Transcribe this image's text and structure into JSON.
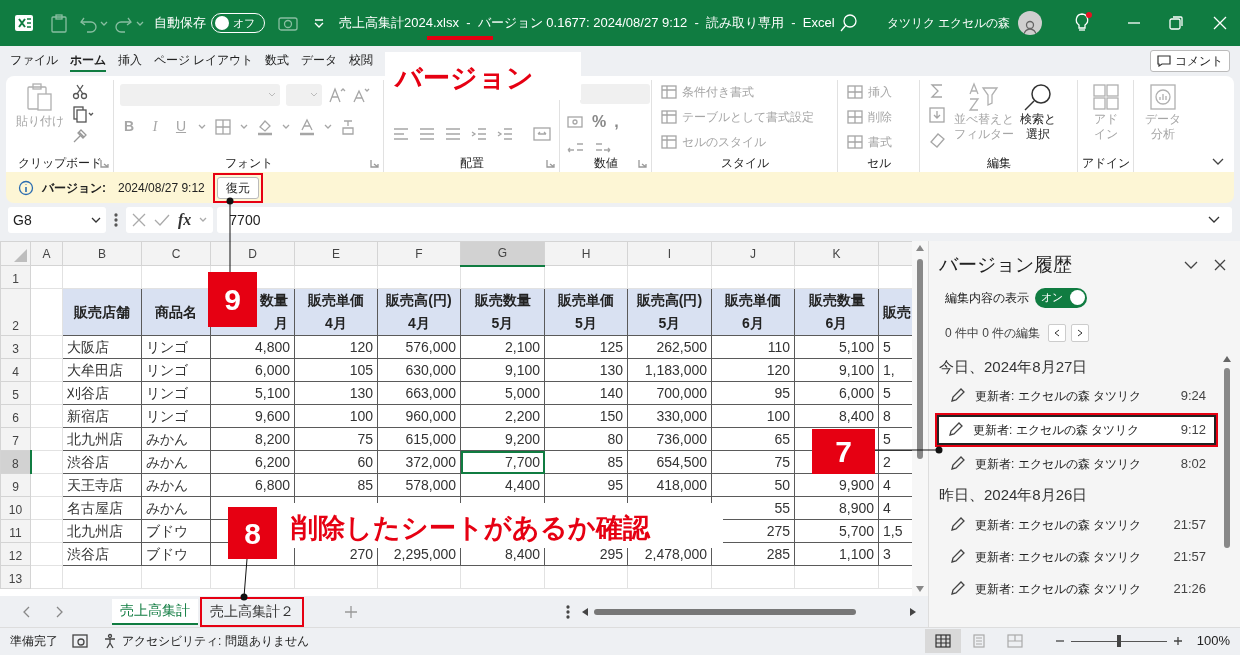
{
  "title_bar": {
    "autosave_label": "自動保存",
    "autosave_on": false,
    "autosave_state": "オフ",
    "title": "売上高集計2024.xlsx  -  バージョン 0.1677: 2024/08/27 9:12  -  読み取り専用  -  Excel",
    "title_underline": true,
    "user": "タツリク エクセルの森",
    "notification": true
  },
  "menu_tabs": [
    {
      "label": "ファイル",
      "selected": false
    },
    {
      "label": "ホーム",
      "selected": true
    },
    {
      "label": "挿入",
      "selected": false
    },
    {
      "label": "ページ レイアウト",
      "selected": false
    },
    {
      "label": "数式",
      "selected": false
    },
    {
      "label": "データ",
      "selected": false
    },
    {
      "label": "校閲",
      "selected": false
    }
  ],
  "comment_button": "コメント",
  "ribbon": {
    "clipboard": {
      "paste": "貼り付け",
      "label": "クリップボード"
    },
    "font": {
      "label": "フォント",
      "format_buttons": [
        "B",
        "I",
        "U"
      ]
    },
    "alignment": {
      "label": "配置"
    },
    "number": {
      "label": "数値",
      "symbols": [
        "%",
        ","
      ]
    },
    "styles": {
      "label": "スタイル",
      "items": [
        "条件付き書式",
        "テーブルとして書式設定",
        "セルのスタイル"
      ]
    },
    "cells": {
      "label": "セル",
      "items": [
        "挿入",
        "削除",
        "書式"
      ]
    },
    "editing": {
      "label": "編集",
      "sort_filter": [
        "並べ替えと",
        "フィルター"
      ],
      "find_select": [
        "検索と",
        "選択"
      ]
    },
    "addins": {
      "label": "アドイン",
      "addins_button": [
        "アド",
        "イン"
      ],
      "data_analysis": [
        "データ",
        "分析"
      ]
    }
  },
  "version_bar": {
    "label": "バージョン:",
    "timestamp": "2024/08/27 9:12",
    "restore_button": "復元",
    "highlighted": true
  },
  "formula_bar": {
    "name_box": "G8",
    "function_label": "fx",
    "value": "7700"
  },
  "sheet": {
    "columns": [
      {
        "label": "A",
        "selected": false
      },
      {
        "label": "B",
        "kind": "text",
        "selected": false
      },
      {
        "label": "C",
        "kind": "text",
        "selected": false
      },
      {
        "label": "D",
        "kind": "number",
        "selected": false
      },
      {
        "label": "E",
        "kind": "number",
        "selected": false
      },
      {
        "label": "F",
        "kind": "number",
        "selected": false
      },
      {
        "label": "G",
        "kind": "number",
        "selected": true
      },
      {
        "label": "H",
        "kind": "number",
        "selected": false
      },
      {
        "label": "I",
        "kind": "number",
        "selected": false
      },
      {
        "label": "J",
        "kind": "number",
        "selected": false
      },
      {
        "label": "K",
        "kind": "number",
        "selected": false
      },
      {
        "kind": "cut",
        "selected": false
      }
    ],
    "rows": [
      {
        "number": "1",
        "kind": "blank",
        "selected": false
      },
      {
        "number": "2",
        "kind": "header",
        "selected": false,
        "cells": [
          {
            "lines": [
              "販売店舗"
            ]
          },
          {
            "lines": [
              "商品名"
            ]
          },
          {
            "lines": [
              "数量",
              "月"
            ],
            "partly_covered": true
          },
          {
            "lines": [
              "販売単価",
              "4月"
            ]
          },
          {
            "lines": [
              "販売高(円)",
              "4月"
            ]
          },
          {
            "lines": [
              "販売数量",
              "5月"
            ]
          },
          {
            "lines": [
              "販売単価",
              "5月"
            ]
          },
          {
            "lines": [
              "販売高(円)",
              "5月"
            ]
          },
          {
            "lines": [
              "販売単価",
              "6月"
            ]
          },
          {
            "lines": [
              "販売数量",
              "6月"
            ]
          },
          {
            "lines": [
              "販売"
            ]
          }
        ]
      },
      {
        "number": "3",
        "kind": "data",
        "selected": false,
        "cells": [
          "大阪店",
          "リンゴ",
          "4,800",
          "120",
          "576,000",
          "2,100",
          "125",
          "262,500",
          "110",
          "5,100",
          "5"
        ]
      },
      {
        "number": "4",
        "kind": "data",
        "selected": false,
        "cells": [
          "大牟田店",
          "リンゴ",
          "6,000",
          "105",
          "630,000",
          "9,100",
          "130",
          "1,183,000",
          "120",
          "9,100",
          "1,"
        ]
      },
      {
        "number": "5",
        "kind": "data",
        "selected": false,
        "cells": [
          "刈谷店",
          "リンゴ",
          "5,100",
          "130",
          "663,000",
          "5,000",
          "140",
          "700,000",
          "95",
          "6,000",
          "5"
        ]
      },
      {
        "number": "6",
        "kind": "data",
        "selected": false,
        "cells": [
          "新宿店",
          "リンゴ",
          "9,600",
          "100",
          "960,000",
          "2,200",
          "150",
          "330,000",
          "100",
          "8,400",
          "8"
        ]
      },
      {
        "number": "7",
        "kind": "data",
        "selected": false,
        "cells": [
          "北九州店",
          "みかん",
          "8,200",
          "75",
          "615,000",
          "9,200",
          "80",
          "736,000",
          "65",
          null,
          "5"
        ]
      },
      {
        "number": "8",
        "kind": "data",
        "selected": true,
        "cells": [
          "渋谷店",
          "みかん",
          "6,200",
          "60",
          "372,000",
          "7,700",
          "85",
          "654,500",
          "75",
          null,
          "2"
        ]
      },
      {
        "number": "9",
        "kind": "data",
        "selected": false,
        "cells": [
          "天王寺店",
          "みかん",
          "6,800",
          "85",
          "578,000",
          "4,400",
          "95",
          "418,000",
          "50",
          "9,900",
          "4"
        ]
      },
      {
        "number": "10",
        "kind": "data",
        "selected": false,
        "cells": [
          "名古屋店",
          "みかん",
          null,
          null,
          null,
          null,
          null,
          null,
          "55",
          "8,900",
          "4"
        ]
      },
      {
        "number": "11",
        "kind": "data",
        "selected": false,
        "cells": [
          "北九州店",
          "ブドウ",
          null,
          null,
          null,
          null,
          null,
          null,
          "275",
          "5,700",
          "1,5"
        ]
      },
      {
        "number": "12",
        "kind": "data",
        "selected": false,
        "cells": [
          "渋谷店",
          "ブドウ",
          null,
          "270",
          "2,295,000",
          "8,400",
          "295",
          "2,478,000",
          "285",
          "1,100",
          "3"
        ]
      },
      {
        "number": "13",
        "kind": "blank",
        "selected": false
      }
    ]
  },
  "sheet_tabs": [
    {
      "label": "売上高集計",
      "selected": true,
      "highlighted": false
    },
    {
      "label": "売上高集計２",
      "selected": false,
      "highlighted": true
    }
  ],
  "panel": {
    "title": "バージョン履歴",
    "show_changes_label": "編集内容の表示",
    "show_changes_on": true,
    "show_changes_state": "オン",
    "edit_count": "0 件中 0 件の編集",
    "groups": [
      {
        "heading": "今日、2024年8月27日",
        "versions": [
          {
            "author": "更新者: エクセルの森 タツリク",
            "time": "9:24",
            "selected": false,
            "highlighted": false
          },
          {
            "author": "更新者: エクセルの森 タツリク",
            "time": "9:12",
            "selected": true,
            "highlighted": true
          },
          {
            "author": "更新者: エクセルの森 タツリク",
            "time": "8:02",
            "selected": false,
            "highlighted": false
          }
        ]
      },
      {
        "heading": "昨日、2024年8月26日",
        "versions": [
          {
            "author": "更新者: エクセルの森 タツリク",
            "time": "21:57",
            "selected": false,
            "highlighted": false
          },
          {
            "author": "更新者: エクセルの森 タツリク",
            "time": "21:57",
            "selected": false,
            "highlighted": false
          },
          {
            "author": "更新者: エクセルの森 タツリク",
            "time": "21:26",
            "selected": false,
            "highlighted": false
          }
        ]
      }
    ]
  },
  "status_bar": {
    "ready": "準備完了",
    "accessibility": "アクセシビリティ: 問題ありません",
    "views": [
      {
        "kind": "normal",
        "selected": true
      },
      {
        "kind": "page_layout",
        "selected": false
      },
      {
        "kind": "page_break",
        "selected": false
      }
    ],
    "zoom_slider": {
      "level": 0.5
    },
    "zoom": "100%"
  },
  "annotations": {
    "label": "バージョン",
    "markers": [
      {
        "kind": "restore",
        "number": "9"
      },
      {
        "kind": "sheet_tab",
        "number": "8",
        "note": "削除したシートがあるか確認"
      },
      {
        "kind": "version",
        "number": "7"
      }
    ]
  }
}
